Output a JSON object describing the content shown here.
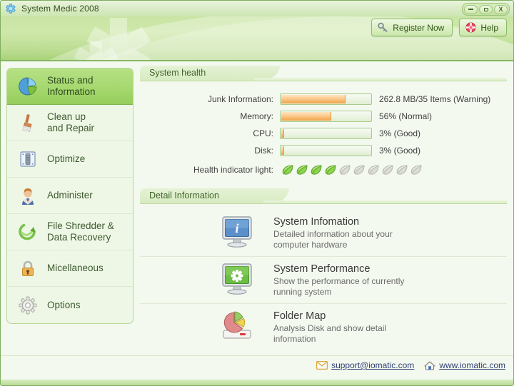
{
  "window": {
    "title": "System Medic 2008",
    "app_icon": "medical-asterisk-icon",
    "buttons": {
      "minimize": "–",
      "maximize": "□",
      "close": "X"
    }
  },
  "header": {
    "register_label": "Register Now",
    "register_icon": "key-icon",
    "help_label": "Help",
    "help_icon": "lifebuoy-icon"
  },
  "sidebar": {
    "items": [
      {
        "label": "Status and\nInformation",
        "icon": "pie-chart-icon",
        "active": true
      },
      {
        "label": "Clean up\nand Repair",
        "icon": "broom-icon",
        "active": false
      },
      {
        "label": "Optimize",
        "icon": "chip-icon",
        "active": false
      },
      {
        "label": "Administer",
        "icon": "user-icon",
        "active": false
      },
      {
        "label": "File Shredder &\nData Recovery",
        "icon": "recycle-icon",
        "active": false
      },
      {
        "label": "Micellaneous",
        "icon": "padlock-icon",
        "active": false
      },
      {
        "label": "Options",
        "icon": "gear-icon",
        "active": false
      }
    ]
  },
  "system_health": {
    "title": "System health",
    "rows": [
      {
        "label": "Junk Information:",
        "percent": 72,
        "value": "262.8 MB/35 Items (Warning)"
      },
      {
        "label": "Memory:",
        "percent": 56,
        "value": "56% (Normal)"
      },
      {
        "label": "CPU:",
        "percent": 3,
        "value": "3% (Good)"
      },
      {
        "label": "Disk:",
        "percent": 3,
        "value": "3% (Good)"
      }
    ],
    "indicator_label": "Health indicator light:",
    "indicator_total": 10,
    "indicator_lit": 4
  },
  "detail_information": {
    "title": "Detail Information",
    "items": [
      {
        "title": "System Infomation",
        "desc": "Detailed information about your\ncomputer hardware",
        "icon": "monitor-info-icon"
      },
      {
        "title": "System Performance",
        "desc": "Show the performance of currently\nrunning system",
        "icon": "monitor-gear-icon"
      },
      {
        "title": "Folder Map",
        "desc": "Analysis Disk and show detail\ninformation",
        "icon": "disk-piechart-icon"
      }
    ]
  },
  "footer": {
    "email": "support@iomatic.com",
    "email_icon": "envelope-icon",
    "website": "www.iomatic.com",
    "website_icon": "home-icon"
  },
  "colors": {
    "accent_green": "#8cc63f",
    "header_green": "#c9e4a4",
    "bar_orange": "#f0a347",
    "link_blue": "#2f3f75",
    "page_bg": "#f4f9ef"
  }
}
